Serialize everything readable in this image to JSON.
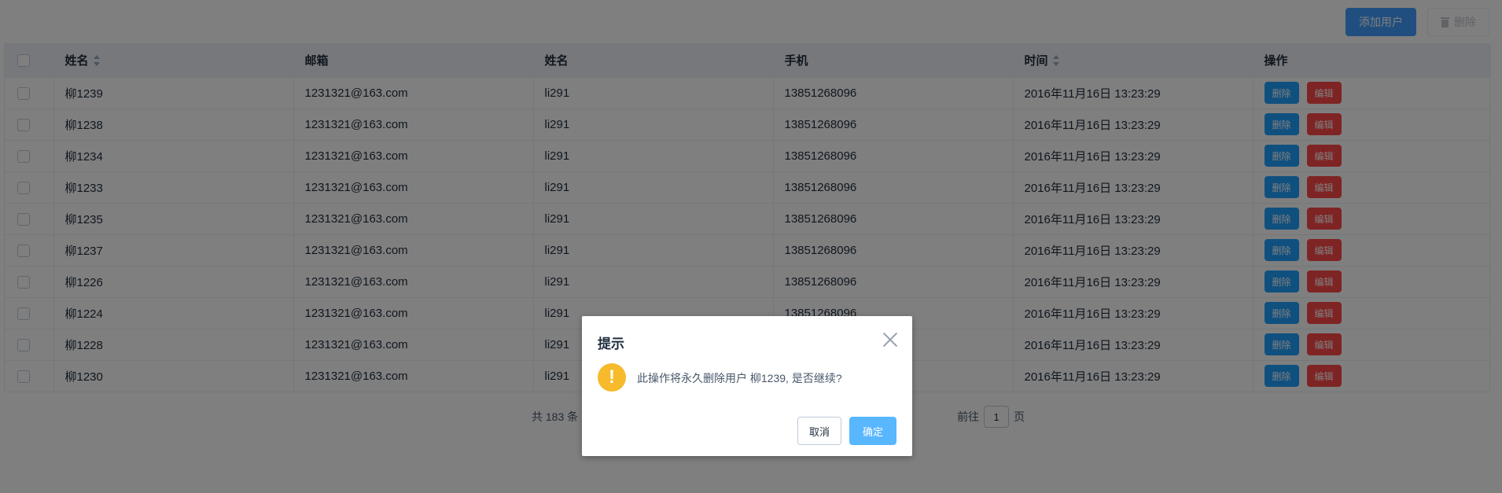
{
  "toolbar": {
    "add_label": "添加用户",
    "delete_label": "删除"
  },
  "table": {
    "headers": {
      "name": "姓名",
      "email": "邮箱",
      "name2": "姓名",
      "phone": "手机",
      "time": "时间",
      "ops": "操作"
    },
    "rows": [
      {
        "name": "柳1239",
        "email": "1231321@163.com",
        "name2": "li291",
        "phone": "13851268096",
        "time": "2016年11月16日 13:23:29"
      },
      {
        "name": "柳1238",
        "email": "1231321@163.com",
        "name2": "li291",
        "phone": "13851268096",
        "time": "2016年11月16日 13:23:29"
      },
      {
        "name": "柳1234",
        "email": "1231321@163.com",
        "name2": "li291",
        "phone": "13851268096",
        "time": "2016年11月16日 13:23:29"
      },
      {
        "name": "柳1233",
        "email": "1231321@163.com",
        "name2": "li291",
        "phone": "13851268096",
        "time": "2016年11月16日 13:23:29"
      },
      {
        "name": "柳1235",
        "email": "1231321@163.com",
        "name2": "li291",
        "phone": "13851268096",
        "time": "2016年11月16日 13:23:29"
      },
      {
        "name": "柳1237",
        "email": "1231321@163.com",
        "name2": "li291",
        "phone": "13851268096",
        "time": "2016年11月16日 13:23:29"
      },
      {
        "name": "柳1226",
        "email": "1231321@163.com",
        "name2": "li291",
        "phone": "13851268096",
        "time": "2016年11月16日 13:23:29"
      },
      {
        "name": "柳1224",
        "email": "1231321@163.com",
        "name2": "li291",
        "phone": "13851268096",
        "time": "2016年11月16日 13:23:29"
      },
      {
        "name": "柳1228",
        "email": "1231321@163.com",
        "name2": "li291",
        "phone": "13851268096",
        "time": "2016年11月16日 13:23:29"
      },
      {
        "name": "柳1230",
        "email": "1231321@163.com",
        "name2": "li291",
        "phone": "13851268096",
        "time": "2016年11月16日 13:23:29"
      }
    ],
    "row_delete_label": "删除",
    "row_edit_label": "编辑"
  },
  "pagination": {
    "total": "共 183 条",
    "goto_prefix": "前往",
    "page_value": "1",
    "goto_suffix": "页"
  },
  "dialog": {
    "title": "提示",
    "message": "此操作将永久删除用户 柳1239, 是否继续?",
    "warn_glyph": "!",
    "cancel_label": "取消",
    "confirm_label": "确定"
  },
  "colors": {
    "primary": "#20a0ff",
    "danger": "#ff4949",
    "warning": "#f7ba2a",
    "confirm": "#58b7ff"
  }
}
